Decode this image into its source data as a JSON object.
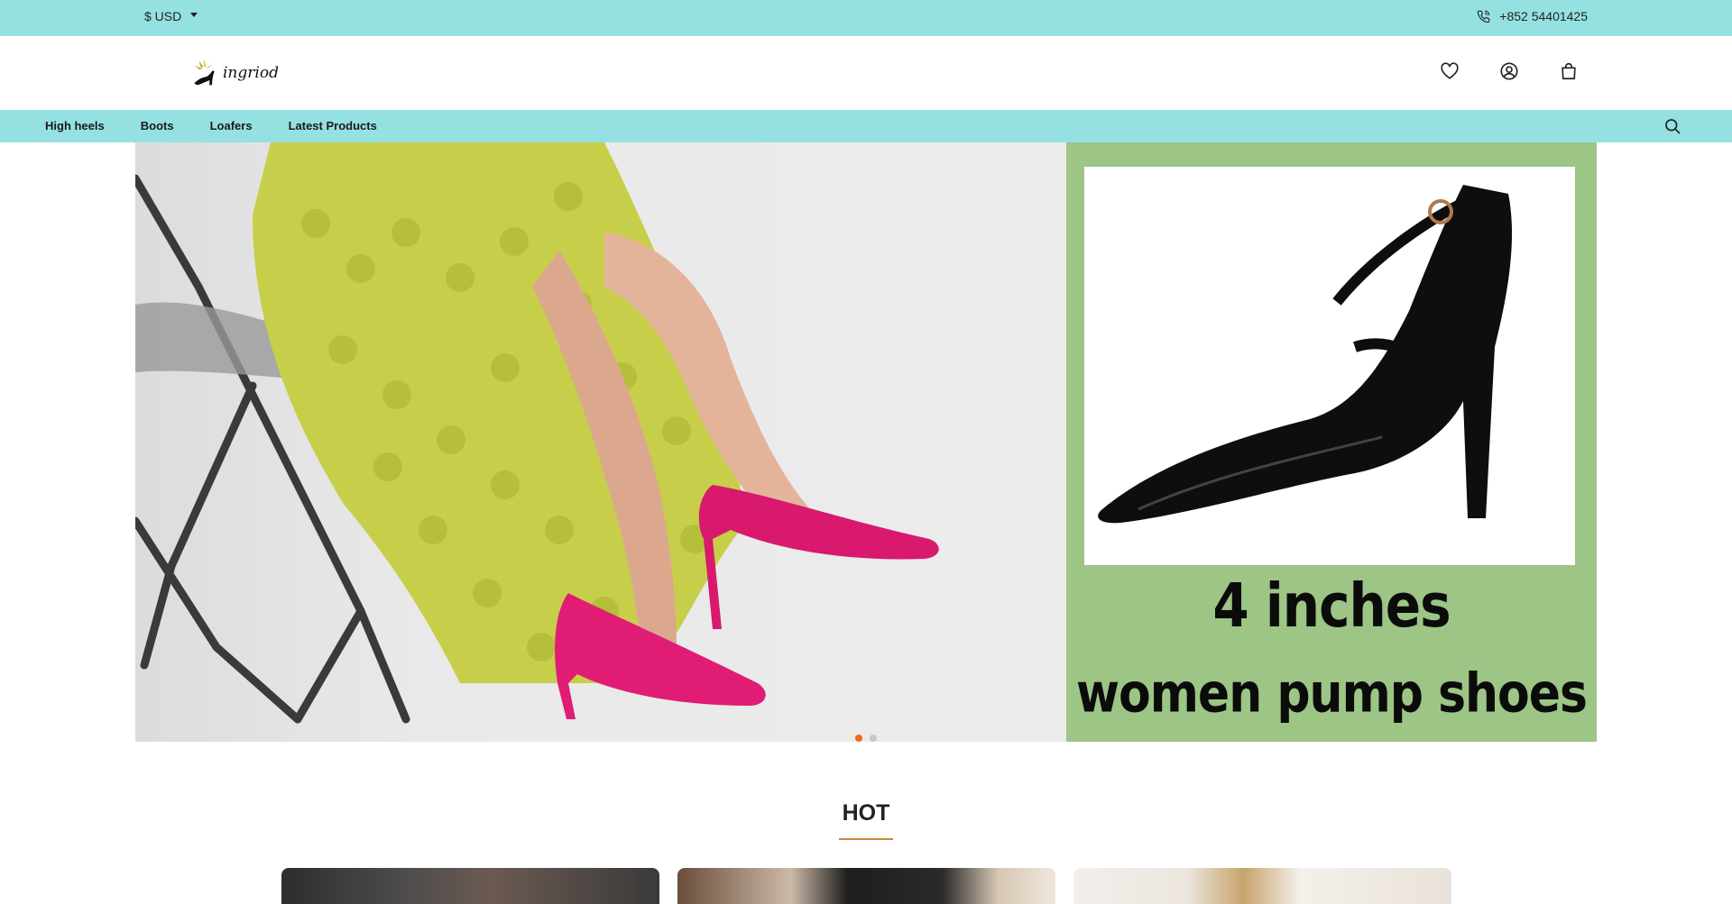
{
  "topbar": {
    "currency": "$ USD",
    "phone": "+852 54401425",
    "phone_icon": "phone-icon"
  },
  "header": {
    "logo_text": "ingriod",
    "icons": [
      "heart-icon",
      "user-icon",
      "bag-icon"
    ]
  },
  "nav": {
    "items": [
      {
        "label": "High heels"
      },
      {
        "label": "Boots"
      },
      {
        "label": "Loafers"
      },
      {
        "label": "Latest Products"
      }
    ],
    "search_icon": "search-icon"
  },
  "hero": {
    "promo_line1": "4 inches",
    "promo_line2": "women pump shoes",
    "slides_total": 2,
    "active_slide": 1,
    "colors": {
      "accent": "#f06a1a",
      "promo_bg": "#9dc585",
      "bar": "#95e1e2"
    }
  },
  "section": {
    "title": "HOT"
  }
}
